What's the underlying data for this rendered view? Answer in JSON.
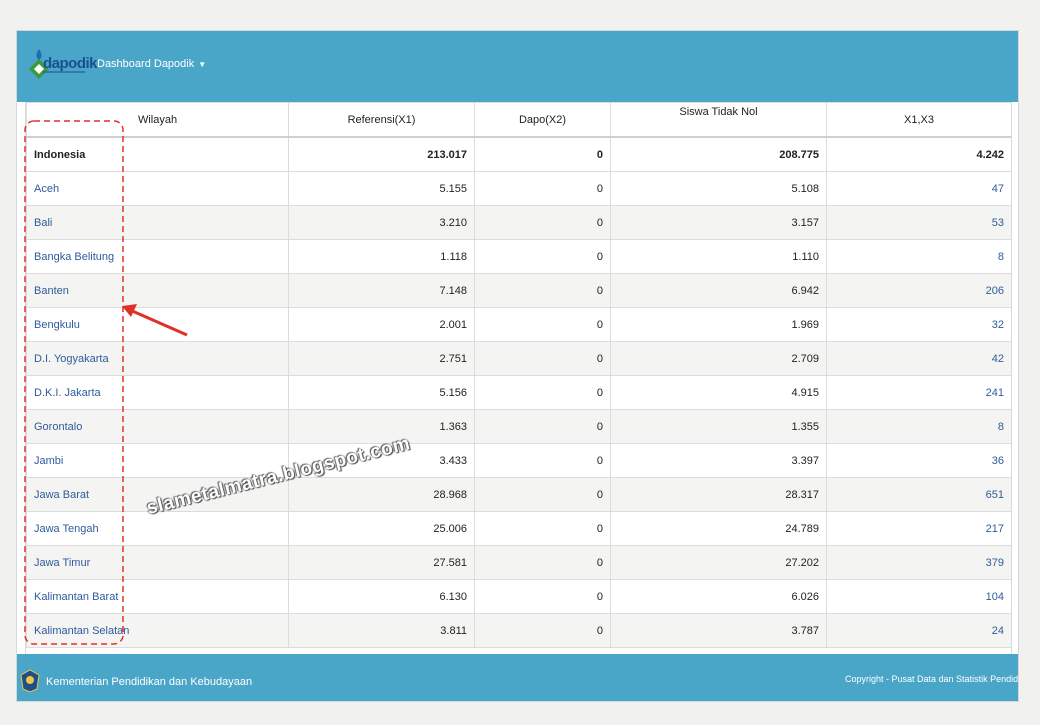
{
  "header": {
    "logo_text": "dapodik",
    "menu_label": "Dashboard Dapodik"
  },
  "table": {
    "columns": [
      "Wilayah",
      "Referensi(X1)",
      "Dapo(X2)",
      "Siswa Tidak Nol",
      "X1,X3"
    ],
    "total": {
      "wilayah": "Indonesia",
      "referensi": "213.017",
      "dapo": "0",
      "siswa": "208.775",
      "x13": "4.242"
    },
    "rows": [
      {
        "wilayah": "Aceh",
        "referensi": "5.155",
        "dapo": "0",
        "siswa": "5.108",
        "x13": "47"
      },
      {
        "wilayah": "Bali",
        "referensi": "3.210",
        "dapo": "0",
        "siswa": "3.157",
        "x13": "53"
      },
      {
        "wilayah": "Bangka Belitung",
        "referensi": "1.118",
        "dapo": "0",
        "siswa": "1.110",
        "x13": "8"
      },
      {
        "wilayah": "Banten",
        "referensi": "7.148",
        "dapo": "0",
        "siswa": "6.942",
        "x13": "206"
      },
      {
        "wilayah": "Bengkulu",
        "referensi": "2.001",
        "dapo": "0",
        "siswa": "1.969",
        "x13": "32"
      },
      {
        "wilayah": "D.I. Yogyakarta",
        "referensi": "2.751",
        "dapo": "0",
        "siswa": "2.709",
        "x13": "42"
      },
      {
        "wilayah": "D.K.I. Jakarta",
        "referensi": "5.156",
        "dapo": "0",
        "siswa": "4.915",
        "x13": "241"
      },
      {
        "wilayah": "Gorontalo",
        "referensi": "1.363",
        "dapo": "0",
        "siswa": "1.355",
        "x13": "8"
      },
      {
        "wilayah": "Jambi",
        "referensi": "3.433",
        "dapo": "0",
        "siswa": "3.397",
        "x13": "36"
      },
      {
        "wilayah": "Jawa Barat",
        "referensi": "28.968",
        "dapo": "0",
        "siswa": "28.317",
        "x13": "651"
      },
      {
        "wilayah": "Jawa Tengah",
        "referensi": "25.006",
        "dapo": "0",
        "siswa": "24.789",
        "x13": "217"
      },
      {
        "wilayah": "Jawa Timur",
        "referensi": "27.581",
        "dapo": "0",
        "siswa": "27.202",
        "x13": "379"
      },
      {
        "wilayah": "Kalimantan Barat",
        "referensi": "6.130",
        "dapo": "0",
        "siswa": "6.026",
        "x13": "104"
      },
      {
        "wilayah": "Kalimantan Selatan",
        "referensi": "3.811",
        "dapo": "0",
        "siswa": "3.787",
        "x13": "24"
      }
    ]
  },
  "footer": {
    "ministry": "Kementerian Pendidikan dan Kebudayaan",
    "copyright": "Copyright - Pusat Data dan Statistik Pendidikan"
  },
  "annotation": {
    "watermark": "slametalmatra.blogspot.com",
    "highlight_color": "#e0302a"
  },
  "colors": {
    "bar": "#4aa6c8",
    "link": "#2f5b9c"
  }
}
